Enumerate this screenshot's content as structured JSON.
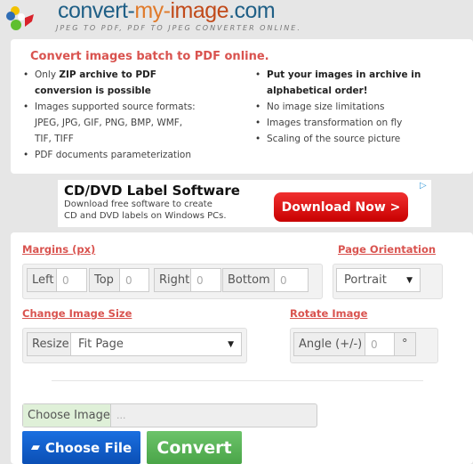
{
  "header": {
    "logo_a": "convert-",
    "logo_b": "my-",
    "logo_c": "image",
    "logo_d": ".com",
    "tagline": "JPEG TO PDF, PDF TO JPEG CONVERTER ONLINE."
  },
  "info": {
    "title": "Convert images batch to PDF online.",
    "left": [
      {
        "pre": "Only ",
        "bold": "ZIP archive to PDF conversion is possible",
        "post": ""
      },
      {
        "pre": "Images supported source formats: JPEG, JPG, GIF, PNG, BMP, WMF, TIF, TIFF",
        "bold": "",
        "post": ""
      },
      {
        "pre": "PDF documents parameterization",
        "bold": "",
        "post": ""
      }
    ],
    "right": [
      {
        "pre": "",
        "bold": "Put your images in archive in alphabetical order!",
        "post": ""
      },
      {
        "pre": "No image size limitations",
        "bold": "",
        "post": ""
      },
      {
        "pre": "Images transformation on fly",
        "bold": "",
        "post": ""
      },
      {
        "pre": "Scaling of the source picture",
        "bold": "",
        "post": ""
      }
    ]
  },
  "ad": {
    "title": "CD/DVD Label Software",
    "line1": "Download free software to create",
    "line2": "CD and DVD labels on Windows PCs.",
    "button": "Download Now >"
  },
  "form": {
    "margins_heading": "Margins (px)",
    "margins": [
      {
        "label": "Left",
        "value": "0"
      },
      {
        "label": "Top",
        "value": "0"
      },
      {
        "label": "Right",
        "value": "0"
      },
      {
        "label": "Bottom",
        "value": "0"
      }
    ],
    "orientation_heading": "Page Orientation",
    "orientation": "Portrait",
    "size_heading": "Change Image Size",
    "resize_label": "Resize",
    "resize": "Fit Page",
    "rotate_heading": "Rotate Image",
    "angle_label": "Angle (+/-)",
    "angle": "0",
    "degree": "°",
    "choose_label": "Choose Image",
    "choose_placeholder": "...",
    "choose_button": "Choose File",
    "convert_button": "Convert"
  },
  "colors": {
    "accent": "#d9534f",
    "blue": "#0b5ed0",
    "green": "#5cb85c"
  }
}
